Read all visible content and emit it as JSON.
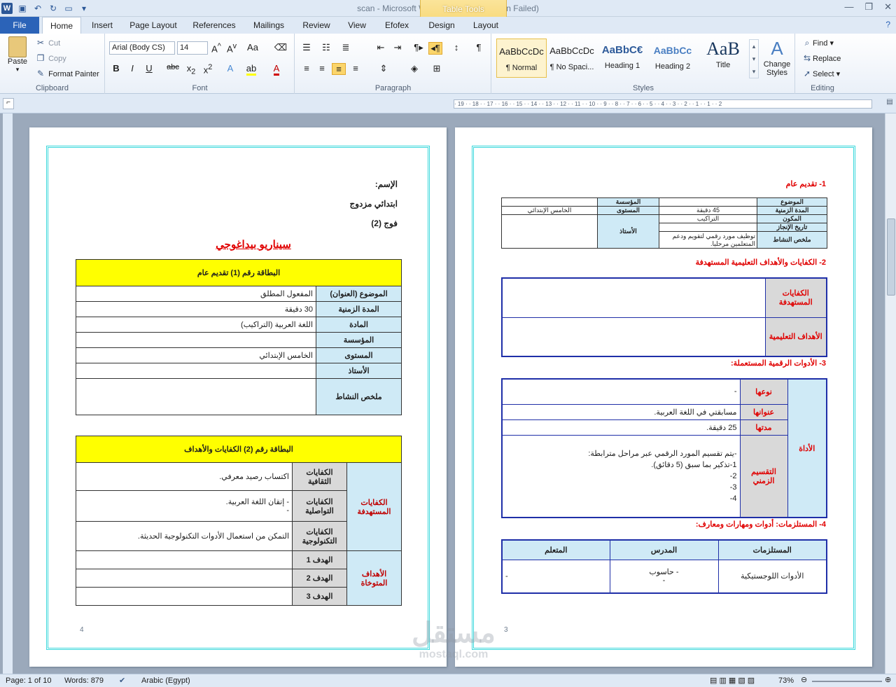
{
  "window": {
    "title": "scan - Microsoft Word (Product Activation Failed)",
    "contextual_tab_group": "Table Tools"
  },
  "tabs": [
    {
      "label": "File"
    },
    {
      "label": "Home"
    },
    {
      "label": "Insert"
    },
    {
      "label": "Page Layout"
    },
    {
      "label": "References"
    },
    {
      "label": "Mailings"
    },
    {
      "label": "Review"
    },
    {
      "label": "View"
    },
    {
      "label": "Efofex"
    },
    {
      "label": "Design"
    },
    {
      "label": "Layout"
    }
  ],
  "clipboard": {
    "paste": "Paste",
    "cut": "Cut",
    "copy": "Copy",
    "format_painter": "Format Painter",
    "group": "Clipboard"
  },
  "font": {
    "name": "Arial (Body CS)",
    "size": "14",
    "group": "Font"
  },
  "paragraph": {
    "group": "Paragraph"
  },
  "styles": {
    "group": "Styles",
    "items": [
      {
        "preview": "AaBbCcDc",
        "name": "¶ Normal"
      },
      {
        "preview": "AaBbCcDc",
        "name": "¶ No Spaci..."
      },
      {
        "preview": "AaBbC€",
        "name": "Heading 1"
      },
      {
        "preview": "AaBbCc",
        "name": "Heading 2"
      },
      {
        "preview": "AaB",
        "name": "Title"
      }
    ],
    "change_styles": "Change Styles"
  },
  "editing": {
    "group": "Editing",
    "find": "Find",
    "replace": "Replace",
    "select": "Select"
  },
  "ruler": {
    "text": "· 19 · · 18 · · 17 · · 16 · · 15 · · 14 · · 13 · · 12 · · 11 · · 10 · · 9 · · 8 · · 7 · · 6 · · 5 · · 4 · · 3 · · 2 · · 1 · · 1 · · 2"
  },
  "left_page": {
    "name_label": "الإسم:",
    "school": "ابتدائي مزدوج",
    "group": "فوج (2)",
    "heading": "سيناريو بيداغوجي",
    "card1_title": "البطاقة رقم (1) تقديم عام",
    "card1_rows": [
      {
        "label": "الموضوع (العنوان)",
        "value": "المفعول المطلق"
      },
      {
        "label": "المدة الزمنية",
        "value": "30 دقيقة"
      },
      {
        "label": "المادة",
        "value": "اللغة العربية (التراكيب)"
      },
      {
        "label": "المؤسسة",
        "value": ""
      },
      {
        "label": "المستوى",
        "value": "الخامس الإبتدائي"
      },
      {
        "label": "الأستاذ",
        "value": ""
      },
      {
        "label": "ملخص النشاط",
        "value": ""
      }
    ],
    "card2_title": "البطاقة رقم (2) الكفايات والأهداف",
    "comp_label": "الكفايات المستهدفة",
    "comp_rows": [
      {
        "label": "الكفايات الثقافية",
        "value": "اكتساب رصيد معرفي."
      },
      {
        "label": "الكفايات التواصلية",
        "value": "- إتقان اللغة العربية.",
        "value2": "-"
      },
      {
        "label": "الكفايات التكنولوجية",
        "value": "التمكن من استعمال الأدوات التكنولوجية الحديثة."
      }
    ],
    "goals_label": "الأهداف المتوخاة",
    "goal_rows": [
      {
        "label": "الهدف 1"
      },
      {
        "label": "الهدف 2"
      },
      {
        "label": "الهدف 3"
      }
    ],
    "page_number": "4"
  },
  "right_page": {
    "sec1": "1- تقديم عام",
    "t1": {
      "r1": {
        "l1": "الموضوع",
        "v1": "",
        "l2": "المؤسسة",
        "v2": ""
      },
      "r2": {
        "l1": "المدة الزمنية",
        "v1": "45 دقيقة",
        "l2": "المستوى",
        "v2": "الخامس الإبتدائي"
      },
      "r3": {
        "l1": "المكون",
        "v1": "التراكيب",
        "l2": "الأستاذ"
      },
      "r4": {
        "l1": "تاريخ الإنجاز",
        "v1": ""
      },
      "r5": {
        "l1": "ملخص النشاط",
        "v1": "توظيف مورد رقمي لتقويم ودعم المتعلمين مرحليا."
      }
    },
    "sec2": "2- الكفايات والأهداف التعليمية المستهدفة",
    "t2": {
      "l1": "الكفايات المستهدفة",
      "l2": "الأهداف التعليمية"
    },
    "sec3": "3- الأدوات الرقمية المستعملة:",
    "t3": {
      "tool": "الأداة",
      "type_l": "نوعها",
      "type_v": "-",
      "title_l": "عنوانها",
      "title_v": "مسابقتي في اللغة العربية.",
      "dur_l": "مدتها",
      "dur_v": "25 دقيقة.",
      "div_l": "التقسيم الزمني",
      "div_lines": [
        "-يتم تقسيم المورد الرقمي عبر مراحل مترابطة:",
        "1-تذكير بما سبق (5 دقائق).",
        "2-",
        "3-",
        "4-"
      ]
    },
    "sec4": "4- المستلزمات: أدوات ومهارات ومعارف:",
    "t4": {
      "h1": "المستلزمات",
      "h2": "المدرس",
      "h3": "المتعلم",
      "r1": "الأدوات اللوجستيكية",
      "teacher1": "- حاسوب",
      "teacher2": "-",
      "learner": "-"
    },
    "page_number": "3"
  },
  "status": {
    "page": "Page: 1 of 10",
    "words": "Words: 879",
    "language": "Arabic (Egypt)",
    "zoom": "73%"
  },
  "watermark": {
    "text": "مستقل",
    "sub": "mostaql.com"
  }
}
